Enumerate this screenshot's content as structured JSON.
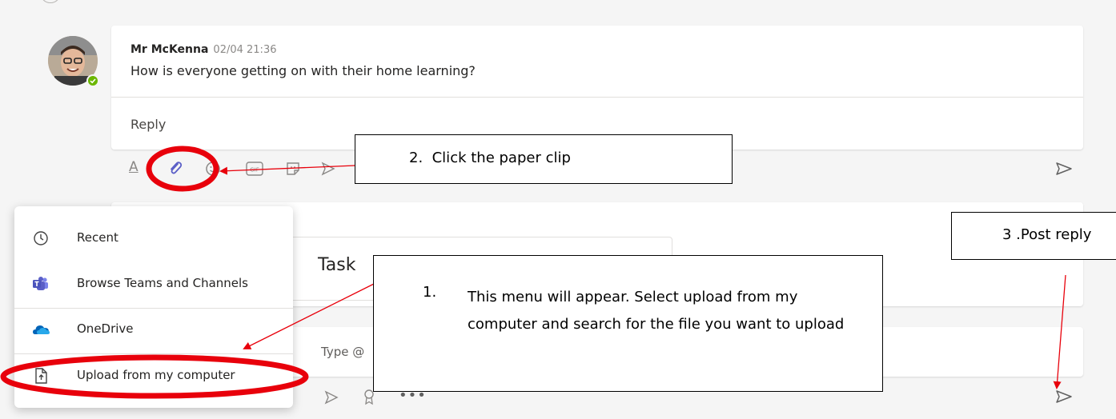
{
  "post": {
    "author": "Mr McKenna",
    "timestamp": "02/04 21:36",
    "message": "How is everyone getting on with their home learning?",
    "reply_label": "Reply"
  },
  "background_card": {
    "title": "Task",
    "compose_placeholder": "Type @"
  },
  "attach_menu": {
    "items": [
      {
        "label": "Recent",
        "icon": "clock-icon"
      },
      {
        "label": "Browse Teams and Channels",
        "icon": "teams-icon"
      },
      {
        "label": "OneDrive",
        "icon": "onedrive-icon"
      },
      {
        "label": "Upload from my computer",
        "icon": "upload-file-icon"
      }
    ]
  },
  "annotations": {
    "step1_number": "1.",
    "step1": "This menu will appear. Select upload from my computer and search for the file you want to upload",
    "step2": "2.  Click the paper clip",
    "step3": "3 .Post reply"
  },
  "colors": {
    "annotation_red": "#e8000b",
    "teams_purple": "#5b5fc7",
    "presence_green": "#6bb700"
  }
}
